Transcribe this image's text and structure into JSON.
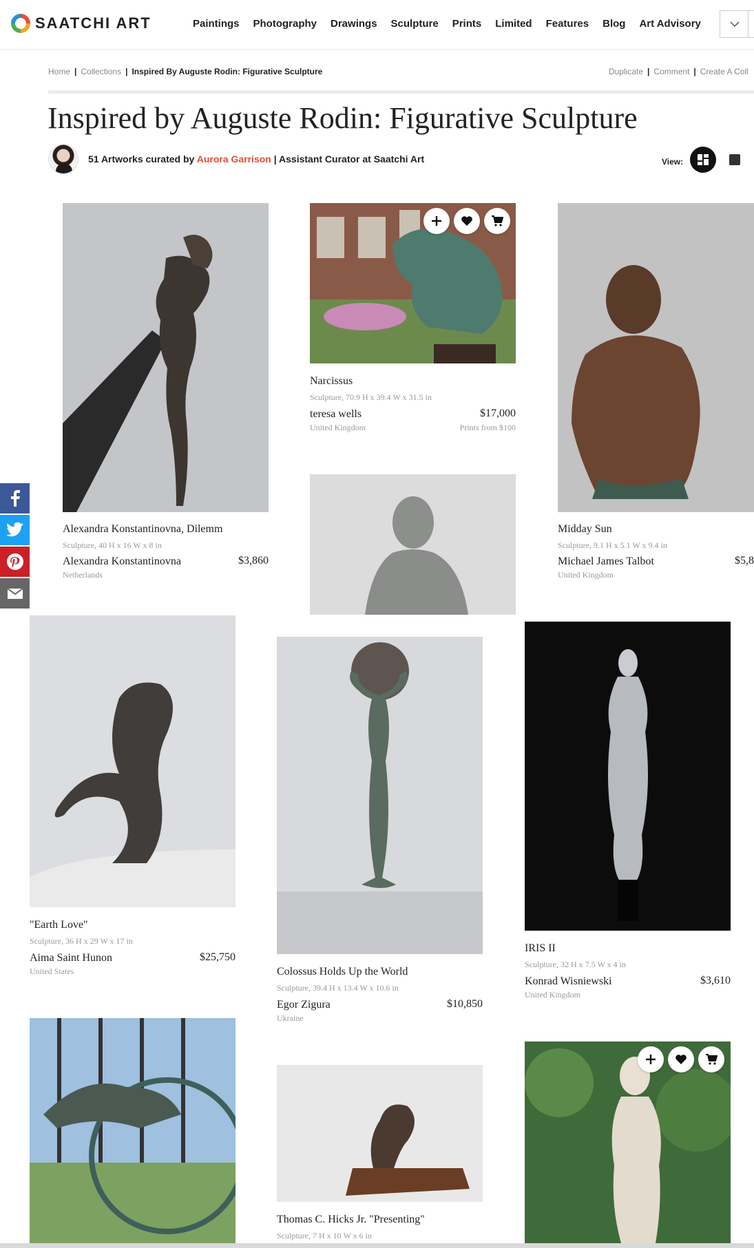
{
  "header": {
    "logo": "SAATCHI ART",
    "nav": [
      "Paintings",
      "Photography",
      "Drawings",
      "Sculpture",
      "Prints",
      "Limited",
      "Features",
      "Blog",
      "Art Advisory"
    ]
  },
  "breadcrumb": {
    "home": "Home",
    "collections": "Collections",
    "current": "Inspired By Auguste Rodin: Figurative Sculpture"
  },
  "actions": {
    "duplicate": "Duplicate",
    "comment": "Comment",
    "create": "Create A Coll"
  },
  "page": {
    "title": "Inspired by Auguste Rodin: Figurative Sculpture",
    "count_text": "51 Artworks curated by",
    "curator": "Aurora Garrison",
    "curator_role": "| Assistant Curator at Saatchi Art",
    "view_label": "View:"
  },
  "artworks": [
    {
      "title": "Alexandra Konstantinovna, Dilemm",
      "meta": "Sculpture, 40 H x 16 W x 8 in",
      "artist": "Alexandra Konstantinovna",
      "country": "Netherlands",
      "price": "$3,860"
    },
    {
      "title": "Narcissus",
      "meta": "Sculpture, 70.9 H x 39.4 W x 31.5 in",
      "artist": "teresa wells",
      "country": "United Kingdom",
      "price": "$17,000",
      "prints": "Prints from $100"
    },
    {
      "title": "Midday Sun",
      "meta": "Sculpture, 9.1 H x 5.1 W x 9.4 in",
      "artist": "Michael James Talbot",
      "country": "United Kingdom",
      "price": "$5,8"
    },
    {
      "title": "\"Earth Love\"",
      "meta": "Sculpture, 36 H x 29 W x 17 in",
      "artist": "Aima Saint Hunon",
      "country": "United States",
      "price": "$25,750"
    },
    {
      "title": "Colossus Holds Up the World",
      "meta": "Sculpture, 39.4 H x 13.4 W x 10.6 in",
      "artist": "Egor Zigura",
      "country": "Ukraine",
      "price": "$10,850"
    },
    {
      "title": "IRIS II",
      "meta": "Sculpture, 32 H x 7.5 W x 4 in",
      "artist": "Konrad Wisniewski",
      "country": "United Kingdom",
      "price": "$3,610"
    },
    {
      "title": "Thomas C. Hicks Jr. \"Presenting\"",
      "meta": "Sculpture, 7 H x 10 W x 6 in"
    }
  ],
  "colors": {
    "accent": "#e94d35",
    "facebook": "#3b5998",
    "twitter": "#1da1f2",
    "pinterest": "#cb2027",
    "email": "#666666"
  },
  "icons": [
    "chevron-down-icon",
    "plus-icon",
    "heart-icon",
    "cart-icon",
    "facebook-icon",
    "twitter-icon",
    "pinterest-icon",
    "email-icon",
    "grid-view-icon",
    "list-view-icon"
  ]
}
